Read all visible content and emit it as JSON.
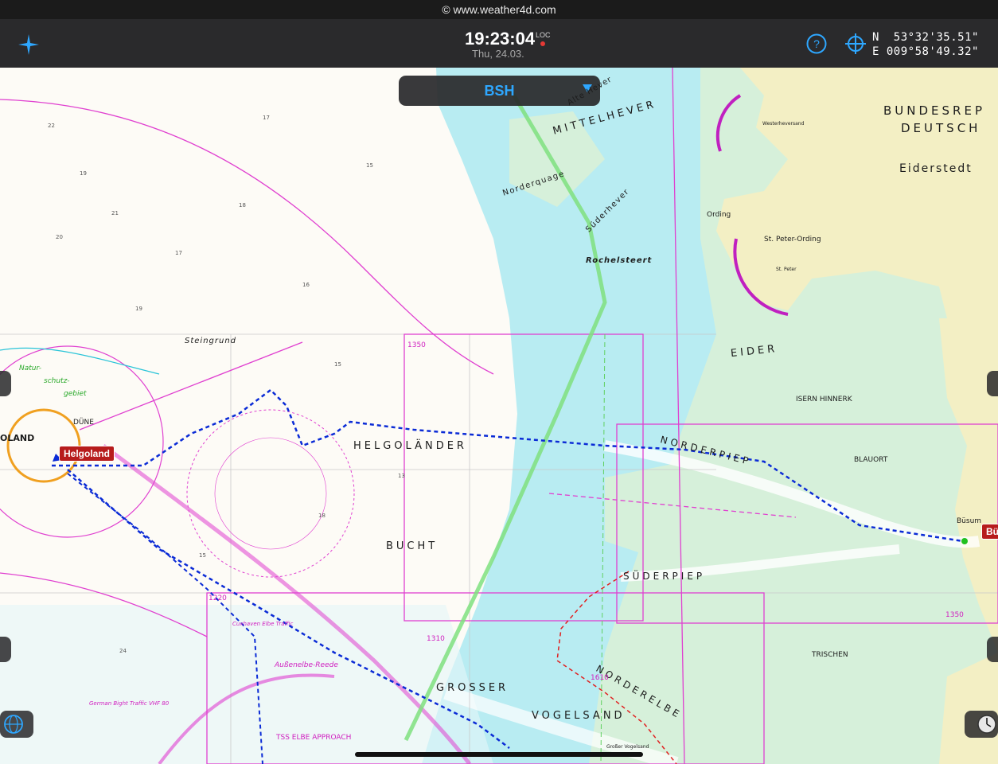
{
  "copyright": "© www.weather4d.com",
  "header": {
    "time": "19:23:04",
    "time_suffix": "LOC",
    "date": "Thu, 24.03.",
    "lat": "N  53°32'35.51\"",
    "lon": "E 009°58'49.32\"",
    "icons": [
      "compass-star-icon",
      "help-icon",
      "crosshair-icon"
    ]
  },
  "chart_source": {
    "selected": "BSH"
  },
  "map_labels": {
    "helgoland": "Helgoland",
    "buesum_tag": "Bü",
    "oland": "OLAND",
    "duene": "DÜNE",
    "helgolaender": "HELGOLÄNDER",
    "bucht": "BUCHT",
    "grosser": "GROSSER",
    "vogelsand": "VOGELSAND",
    "mittelhever": "MITTELHEVER",
    "norderquage": "Norderquage",
    "suederhever": "Süderhever",
    "alte_hever": "Alte Hever",
    "rochelsteert": "Rochelsteert",
    "eider": "EIDER",
    "norderpiep": "NORDERPIEP",
    "suederpiep": "SÜDERPIEP",
    "norderelbe": "NORDERELBE",
    "steingrund": "Steingrund",
    "bundesrep": "BUNDESREP",
    "deutsch": "DEUTSCH",
    "eiderstedt": "Eiderstedt",
    "ording": "Ording",
    "st_peter_ording": "St. Peter-Ording",
    "isern_hinnerk": "ISERN HINNERK",
    "blauort": "BLAUORT",
    "buesum": "Büsum",
    "trischen": "TRISCHEN",
    "natur": "Natur-",
    "schutz": "schutz-",
    "gebiet": "gebiet",
    "westerheversand": "Westerheversand",
    "st_peter": "St. Peter",
    "tss": "TSS ELBE APPROACH",
    "aussenelbe_reede": "Außenelbe-Reede",
    "german_bight_traffic": "German Bight Traffic VHF 80",
    "cuxhaven_traffic": "Cuxhaven Elbe Traffic",
    "depth_1350a": "1350",
    "depth_1350b": "1350",
    "depth_1220": "1220",
    "depth_1310": "1310",
    "depth_1610": "1610",
    "grosser_vogelsand": "Großer Vogelsand"
  },
  "colors": {
    "land": "#f3efc4",
    "land_green": "#e2ecc4",
    "shallow": "#b8ecf2",
    "tidal_flat": "#d6f0da",
    "deep": "#ffffff",
    "boundary_magenta": "#e040d0",
    "route_blue": "#0b2bd6",
    "accent_blue": "#2ea7ff",
    "tag_red": "#b71c1c"
  }
}
